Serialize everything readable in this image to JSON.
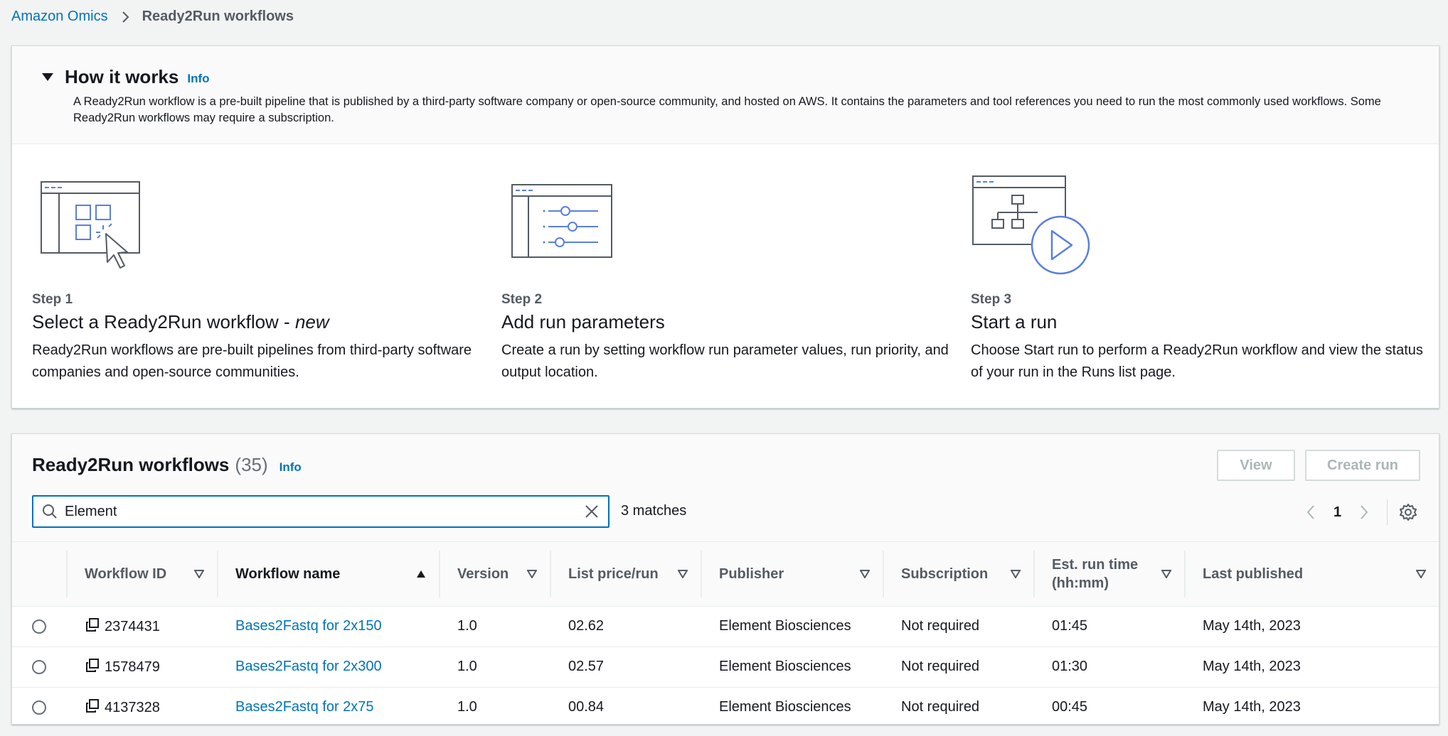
{
  "breadcrumb": {
    "parent": "Amazon Omics",
    "current": "Ready2Run workflows"
  },
  "how_it_works": {
    "title": "How it works",
    "info": "Info",
    "description": "A Ready2Run workflow is a pre-built pipeline that is published by a third-party software company or open-source community, and hosted on AWS. It contains the parameters and tool references you need to run the most commonly used workflows. Some Ready2Run workflows may require a subscription.",
    "steps": [
      {
        "label": "Step 1",
        "title": "Select a Ready2Run workflow - ",
        "title_em": "new",
        "text": "Ready2Run workflows are pre-built pipelines from third-party software companies and open-source communities."
      },
      {
        "label": "Step 2",
        "title": "Add run parameters",
        "title_em": "",
        "text": "Create a run by setting workflow run parameter values, run priority, and output location."
      },
      {
        "label": "Step 3",
        "title": "Start a run",
        "title_em": "",
        "text": "Choose Start run to perform a Ready2Run workflow and view the status of your run in the Runs list page."
      }
    ]
  },
  "workflows": {
    "title": "Ready2Run workflows",
    "count": "(35)",
    "info": "Info",
    "view_label": "View",
    "create_label": "Create run",
    "search_value": "Element",
    "matches": "3 matches",
    "page": "1",
    "columns": [
      "Workflow ID",
      "Workflow name",
      "Version",
      "List price/run",
      "Publisher",
      "Subscription",
      "Est. run time (hh:mm)",
      "Last published"
    ],
    "rows": [
      {
        "id": "2374431",
        "name": "Bases2Fastq for 2x150",
        "version": "1.0",
        "price": "02.62",
        "publisher": "Element Biosciences",
        "subscription": "Not required",
        "runtime": "01:45",
        "published": "May 14th, 2023"
      },
      {
        "id": "1578479",
        "name": "Bases2Fastq for 2x300",
        "version": "1.0",
        "price": "02.57",
        "publisher": "Element Biosciences",
        "subscription": "Not required",
        "runtime": "01:30",
        "published": "May 14th, 2023"
      },
      {
        "id": "4137328",
        "name": "Bases2Fastq for 2x75",
        "version": "1.0",
        "price": "00.84",
        "publisher": "Element Biosciences",
        "subscription": "Not required",
        "runtime": "00:45",
        "published": "May 14th, 2023"
      }
    ]
  },
  "colors": {
    "link": "#0073bb",
    "illustration_blue": "#5a7fde",
    "illustration_dark": "#545b64"
  }
}
